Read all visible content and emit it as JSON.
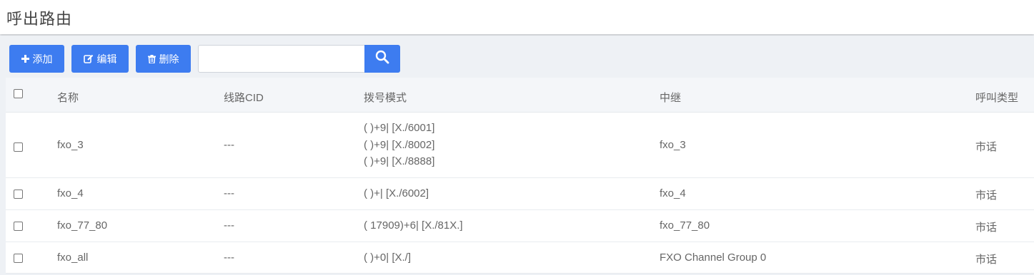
{
  "page": {
    "title": "呼出路由"
  },
  "toolbar": {
    "add_label": "添加",
    "edit_label": "编辑",
    "delete_label": "删除",
    "search_value": "",
    "search_placeholder": ""
  },
  "table": {
    "columns": [
      "名称",
      "线路CID",
      "拨号模式",
      "中继",
      "呼叫类型"
    ],
    "rows": [
      {
        "name": "fxo_3",
        "cid": "---",
        "patterns": [
          "( )+9| [X./6001]",
          "( )+9| [X./8002]",
          "( )+9| [X./8888]"
        ],
        "trunk": "fxo_3",
        "call_type": "市话"
      },
      {
        "name": "fxo_4",
        "cid": "---",
        "patterns": [
          "( )+| [X./6002]"
        ],
        "trunk": "fxo_4",
        "call_type": "市话"
      },
      {
        "name": "fxo_77_80",
        "cid": "---",
        "patterns": [
          "( 17909)+6| [X./81X.]"
        ],
        "trunk": "fxo_77_80",
        "call_type": "市话"
      },
      {
        "name": "fxo_all",
        "cid": "---",
        "patterns": [
          "( )+0| [X./]"
        ],
        "trunk": "FXO Channel Group 0",
        "call_type": "市话"
      }
    ]
  },
  "icons": {
    "add": "plus-icon",
    "edit": "edit-icon",
    "delete": "trash-icon",
    "search": "search-icon"
  },
  "colors": {
    "accent": "#3d7cf0",
    "background": "#eef1f5"
  }
}
